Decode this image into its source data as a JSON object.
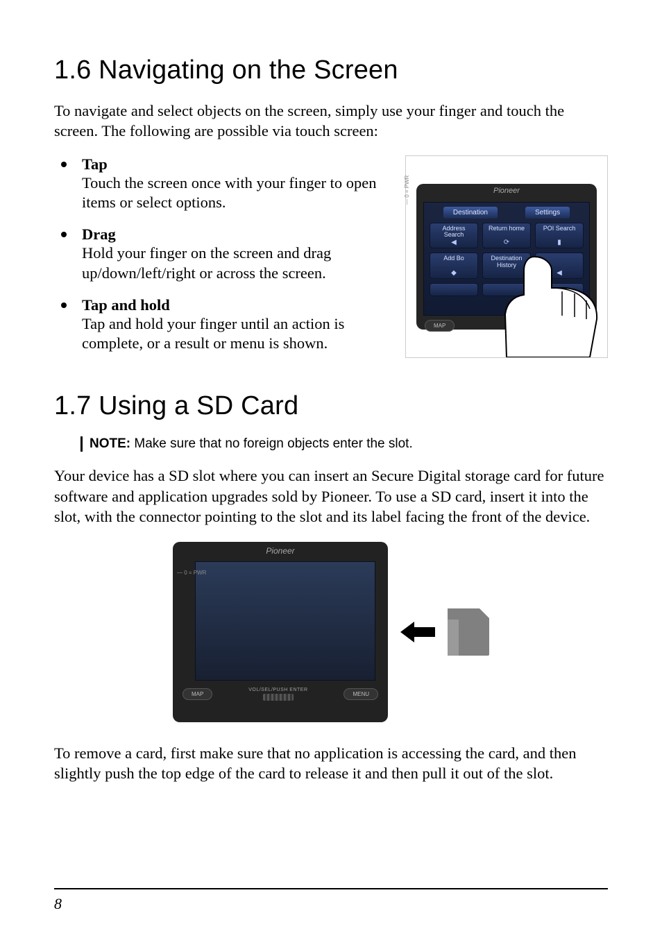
{
  "s16": {
    "heading": "1.6   Navigating on the Screen",
    "intro": "To navigate and select objects on the screen, simply use your finger and touch the screen. The following are possible via touch screen:",
    "items": [
      {
        "title": "Tap",
        "desc": "Touch the screen once with your finger to open items or select options."
      },
      {
        "title": "Drag",
        "desc": "Hold your finger on the screen and drag up/down/left/right or across the screen."
      },
      {
        "title": "Tap and hold",
        "desc": "Tap and hold your finger until an action is complete, or a result or menu is shown."
      }
    ],
    "fig": {
      "brand": "Pioneer",
      "side": "— 0  = PWR",
      "tabs": [
        "Destination",
        "Settings"
      ],
      "buttons": [
        {
          "label": "Address Search",
          "mini": "◀"
        },
        {
          "label": "Return home",
          "mini": "⟳"
        },
        {
          "label": "POI Search",
          "mini": "▮"
        },
        {
          "label": "Add Bo",
          "mini": "◆"
        },
        {
          "label": "Destination History",
          "mini": ""
        },
        {
          "label": "",
          "mini": "◀"
        },
        {
          "label": "",
          "mini": ""
        },
        {
          "label": "",
          "mini": ""
        },
        {
          "label": "",
          "mini": "▶"
        }
      ],
      "hw": [
        "MAP"
      ]
    }
  },
  "s17": {
    "heading": "1.7   Using a SD Card",
    "note_label": "NOTE:",
    "note_text": " Make sure that no foreign objects enter the slot.",
    "para1": "Your device has a SD slot where you can insert an Secure Digital storage card for future software and application upgrades sold by Pioneer. To use a SD card, insert it into the slot, with the connector pointing to the slot and its label facing the front of the device.",
    "fig": {
      "brand": "Pioneer",
      "side": "— 0  = PWR",
      "vol_label": "VOL/SEL/PUSH ENTER",
      "hw": [
        "MAP",
        "MENU"
      ]
    },
    "para2": "To remove a card, first make sure that no application is accessing the card, and then slightly push the top edge of the card to release it and then pull it out of the slot."
  },
  "page_number": "8"
}
